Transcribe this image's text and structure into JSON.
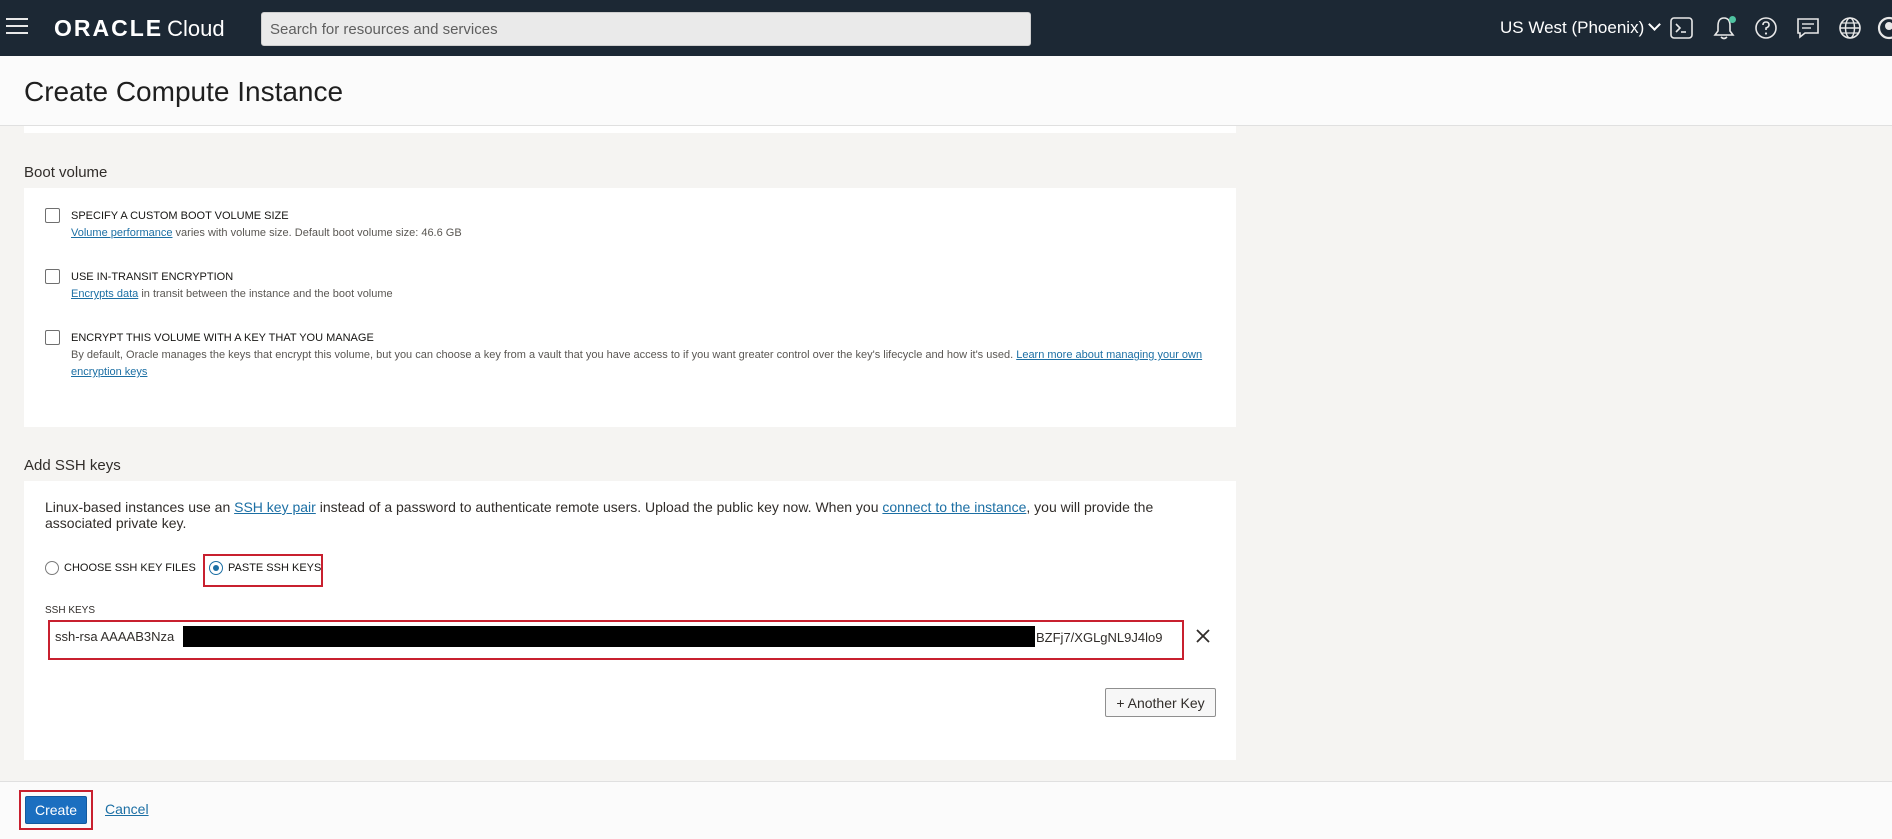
{
  "topbar": {
    "brand_main": "ORACLE",
    "brand_sub": "Cloud",
    "search_placeholder": "Search for resources and services",
    "region": "US West (Phoenix)",
    "icons": [
      "menu-icon",
      "cloud-shell-icon",
      "bell-icon",
      "help-icon",
      "chat-icon",
      "globe-icon",
      "profile-icon"
    ]
  },
  "page": {
    "title": "Create Compute Instance"
  },
  "boot_volume": {
    "title": "Boot volume",
    "options": [
      {
        "label": "SPECIFY A CUSTOM BOOT VOLUME SIZE",
        "link": "Volume performance",
        "desc": " varies with volume size. Default boot volume size: 46.6 GB",
        "checked": false
      },
      {
        "label": "USE IN-TRANSIT ENCRYPTION",
        "link": "Encrypts data",
        "desc": " in transit between the instance and the boot volume",
        "checked": false
      },
      {
        "label": "ENCRYPT THIS VOLUME WITH A KEY THAT YOU MANAGE",
        "desc": "By default, Oracle manages the keys that encrypt this volume, but you can choose a key from a vault that you have access to if you want greater control over the key's lifecycle and how it's used. ",
        "link": "Learn more about managing your own encryption keys",
        "checked": false
      }
    ]
  },
  "ssh": {
    "title": "Add SSH keys",
    "intro_1": "Linux-based instances use an ",
    "intro_link_1": "SSH key pair",
    "intro_2": " instead of a password to authenticate remote users. Upload the public key now. When you ",
    "intro_link_2": "connect to the instance",
    "intro_3": ", you will provide the associated private key.",
    "radio_files": "CHOOSE SSH KEY FILES",
    "radio_paste": "PASTE SSH KEYS",
    "selected": "PASTE SSH KEYS",
    "field_label": "SSH KEYS",
    "key_value_start": "ssh-rsa AAAAB3Nza",
    "key_value_end": "BZFj7/XGLgNL9J4lo9",
    "another_key": "+ Another Key"
  },
  "footer": {
    "create": "Create",
    "cancel": "Cancel"
  },
  "colors": {
    "topbar": "#1c2834",
    "primary": "#1b6fc0",
    "link": "#1c6fa4",
    "highlight": "#c8202f"
  }
}
